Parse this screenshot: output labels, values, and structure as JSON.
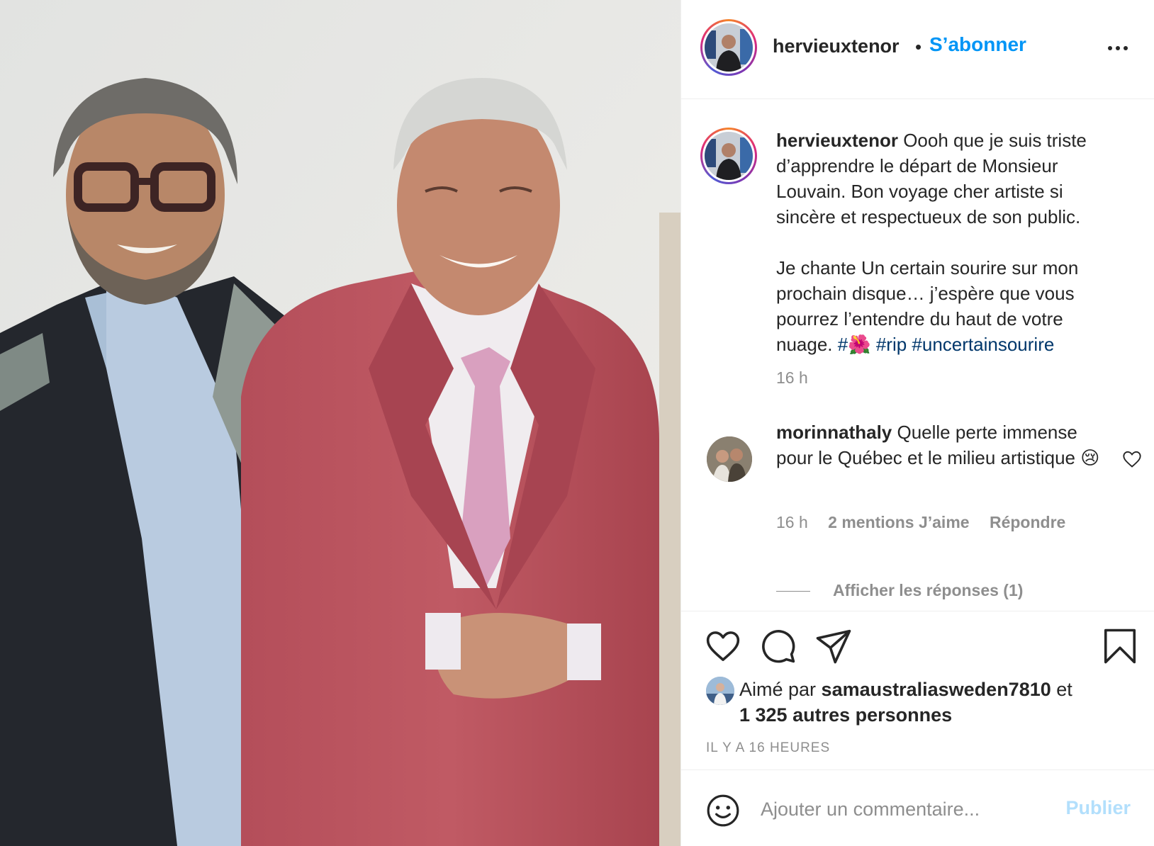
{
  "post": {
    "username": "hervieuxtenor",
    "follow_separator": "•",
    "follow_label": "S’abonner",
    "more_icon": "more-options-icon"
  },
  "caption": {
    "username": "hervieuxtenor",
    "text": "Oooh que je suis triste d’apprendre le départ de Monsieur Louvain. Bon voyage cher artiste si sincère et respectueux de son public.\n\nJe chante Un certain sourire sur mon prochain disque… j’espère que vous pourrez l’entendre du haut de votre nuage. ",
    "hashtags": [
      "#🌺",
      "#rip",
      "#uncertainsourire"
    ],
    "time": "16 h"
  },
  "comment": {
    "username": "morinnathaly",
    "text": "Quelle perte immense pour le Québec et le milieu artistique 😢",
    "time": "16 h",
    "likes": "2 mentions J’aime",
    "reply_label": "Répondre",
    "view_replies": "Afficher les réponses (1)"
  },
  "actions": {
    "like_icon": "heart-icon",
    "comment_icon": "comment-icon",
    "share_icon": "share-icon",
    "save_icon": "bookmark-icon"
  },
  "likes": {
    "prefix": "Aimé par ",
    "user": "samaustraliasweden7810",
    "connector": " et",
    "others": "1 325 autres personnes"
  },
  "timestamp": "IL Y A 16 HEURES",
  "add_comment": {
    "placeholder": "Ajouter un commentaire...",
    "publish_label": "Publier"
  },
  "colors": {
    "accent": "#0095f6",
    "hashtag": "#00376b",
    "muted": "#8e8e8e",
    "publish_disabled": "#b2dffc"
  }
}
